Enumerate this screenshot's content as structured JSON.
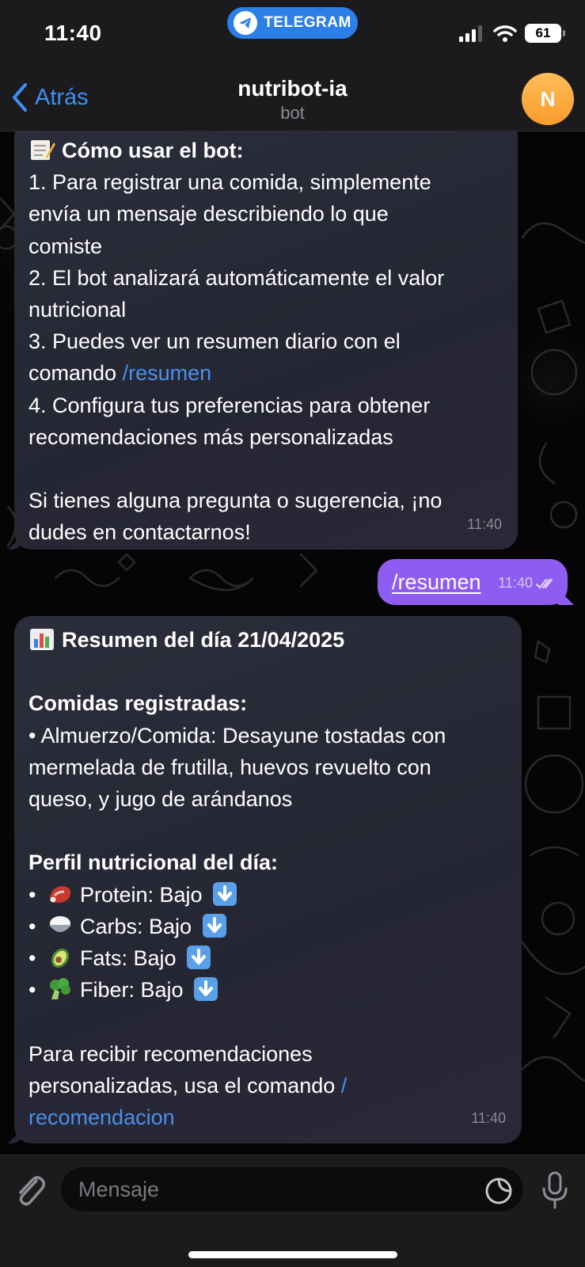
{
  "status_bar": {
    "time": "11:40",
    "app_pill": "TELEGRAM",
    "battery": "61",
    "icons": [
      "signal-icon",
      "wifi-icon",
      "battery-icon"
    ]
  },
  "header": {
    "back_label": "Atrás",
    "title": "nutribot-ia",
    "subtitle": "bot",
    "avatar_letter": "N",
    "avatar_color": "#f9a23a"
  },
  "messages": {
    "help": {
      "heading": "Cómo usar el bot:",
      "lines": [
        "1. Para registrar una comida, simplemente",
        "envía un mensaje describiendo lo que",
        "comiste",
        "2. El bot analizará automáticamente el valor",
        "nutricional",
        "3. Puedes ver un resumen diario con el",
        "comando ",
        "4. Configura tus preferencias para obtener",
        "recomendaciones más personalizadas",
        "Si tienes alguna pregunta o sugerencia, ¡no",
        "dudes en contactarnos!"
      ],
      "command": "/resumen",
      "time": "11:40"
    },
    "user_command": {
      "text": "/resumen",
      "time": "11:40"
    },
    "summary": {
      "title": "Resumen del día 21/04/2025",
      "meals_heading": "Comidas registradas:",
      "meal_lines": [
        "• Almuerzo/Comida: Desayune tostadas con",
        "mermelada de frutilla, huevos revuelto con",
        "queso, y jugo de arándanos"
      ],
      "profile_heading": "Perfil nutricional del día:",
      "nutrients": [
        {
          "emoji": "meat-icon",
          "label": "Protein: Bajo"
        },
        {
          "emoji": "rice-icon",
          "label": "Carbs: Bajo"
        },
        {
          "emoji": "avocado-icon",
          "label": "Fats: Bajo"
        },
        {
          "emoji": "broccoli-icon",
          "label": "Fiber: Bajo"
        }
      ],
      "rec_lines": [
        "Para recibir recomendaciones",
        "personalizadas, usa el comando "
      ],
      "rec_command_part1": "/",
      "rec_command_part2": "recomendacion",
      "time": "11:40"
    }
  },
  "input": {
    "placeholder": "Mensaje"
  },
  "colors": {
    "accent": "#3e8ef7",
    "outgoing_bubble": "#8f5cf2",
    "link": "#4a90f0"
  }
}
